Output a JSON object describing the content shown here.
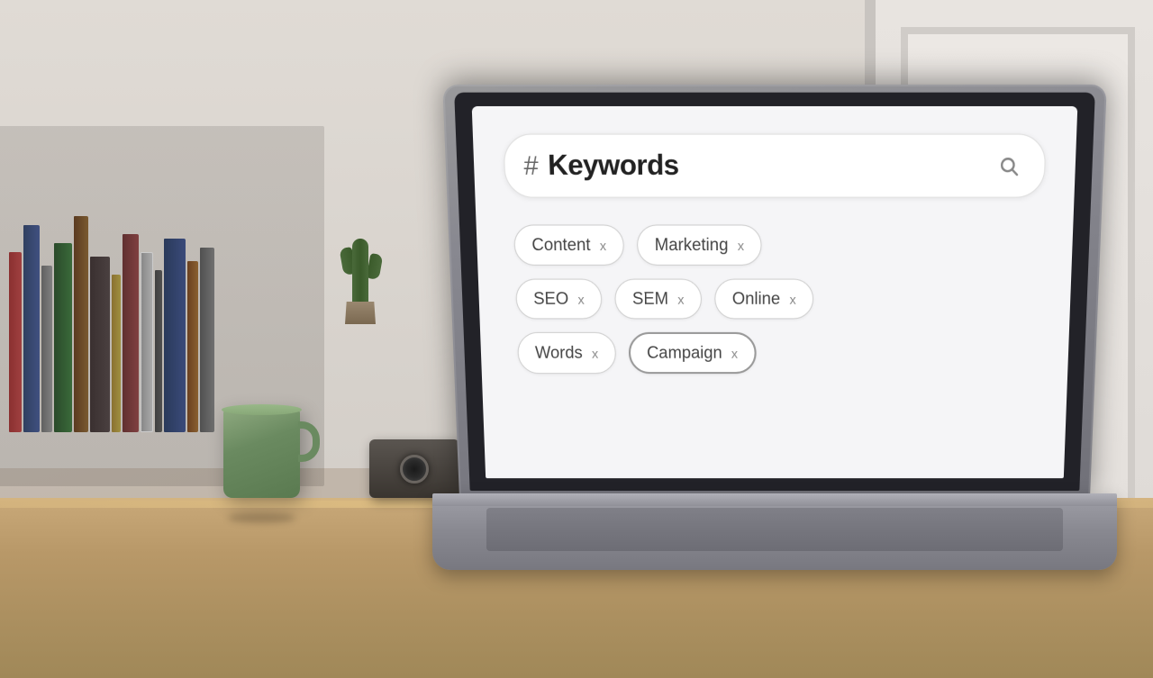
{
  "scene": {
    "background_color": "#c8bfb0"
  },
  "laptop": {
    "screen": {
      "search_bar": {
        "hash_symbol": "#",
        "placeholder": "Keywords",
        "search_icon": "🔍"
      },
      "tags": [
        {
          "row": 1,
          "items": [
            {
              "label": "Content",
              "selected": false
            },
            {
              "label": "Marketing",
              "selected": false
            }
          ]
        },
        {
          "row": 2,
          "items": [
            {
              "label": "SEO",
              "selected": false
            },
            {
              "label": "SEM",
              "selected": false
            },
            {
              "label": "Online",
              "selected": false
            }
          ]
        },
        {
          "row": 3,
          "items": [
            {
              "label": "Words",
              "selected": false
            },
            {
              "label": "Campaign",
              "selected": true
            }
          ]
        }
      ]
    }
  },
  "ui": {
    "tag_close_symbol": "x",
    "search_icon_symbol": "⌕"
  }
}
